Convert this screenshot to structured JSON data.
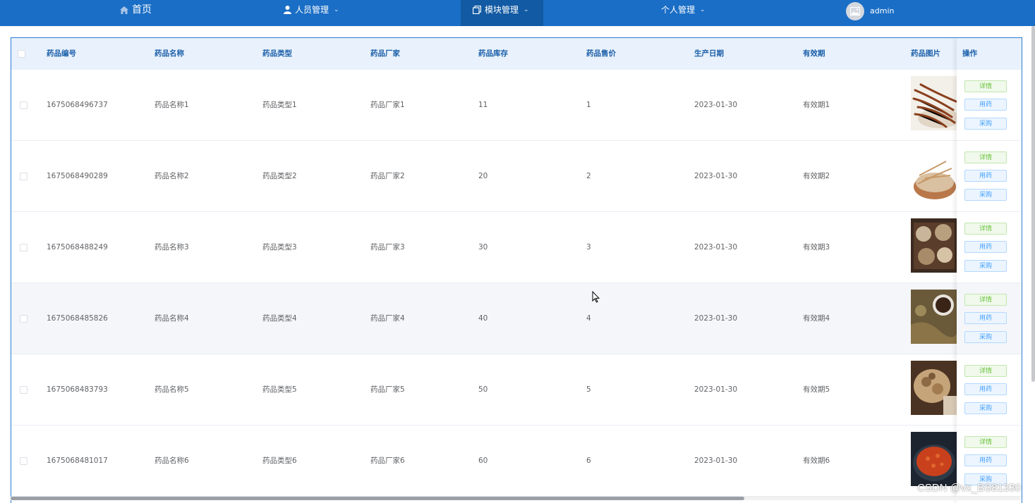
{
  "nav": {
    "home": "首页",
    "personnel": "人员管理",
    "modules": "模块管理",
    "personal": "个人管理",
    "user": "admin"
  },
  "table": {
    "headers": {
      "id": "药品编号",
      "name": "药品名称",
      "type": "药品类型",
      "maker": "药品厂家",
      "stock": "药品库存",
      "price": "药品售价",
      "date": "生产日期",
      "valid": "有效期",
      "image": "药品图片",
      "ops": "操作"
    },
    "rows": [
      {
        "id": "1675068496737",
        "name": "药品名称1",
        "type": "药品类型1",
        "maker": "药品厂家1",
        "stock": "11",
        "price": "1",
        "date": "2023-01-30",
        "valid": "有效期1"
      },
      {
        "id": "1675068490289",
        "name": "药品名称2",
        "type": "药品类型2",
        "maker": "药品厂家2",
        "stock": "20",
        "price": "2",
        "date": "2023-01-30",
        "valid": "有效期2"
      },
      {
        "id": "1675068488249",
        "name": "药品名称3",
        "type": "药品类型3",
        "maker": "药品厂家3",
        "stock": "30",
        "price": "3",
        "date": "2023-01-30",
        "valid": "有效期3"
      },
      {
        "id": "1675068485826",
        "name": "药品名称4",
        "type": "药品类型4",
        "maker": "药品厂家4",
        "stock": "40",
        "price": "4",
        "date": "2023-01-30",
        "valid": "有效期4"
      },
      {
        "id": "1675068483793",
        "name": "药品名称5",
        "type": "药品类型5",
        "maker": "药品厂家5",
        "stock": "50",
        "price": "5",
        "date": "2023-01-30",
        "valid": "有效期5"
      },
      {
        "id": "1675068481017",
        "name": "药品名称6",
        "type": "药品类型6",
        "maker": "药品厂家6",
        "stock": "60",
        "price": "6",
        "date": "2023-01-30",
        "valid": "有效期6"
      }
    ],
    "buttons": {
      "detail": "详情",
      "use": "用药",
      "buy": "采购"
    }
  },
  "watermark": "CSDN @vx_BS81330",
  "colors": {
    "nav_bg": "#1a6ec6",
    "nav_active": "#125aa3",
    "header_bg": "#e8f1fc",
    "header_text": "#1b5fa9"
  }
}
